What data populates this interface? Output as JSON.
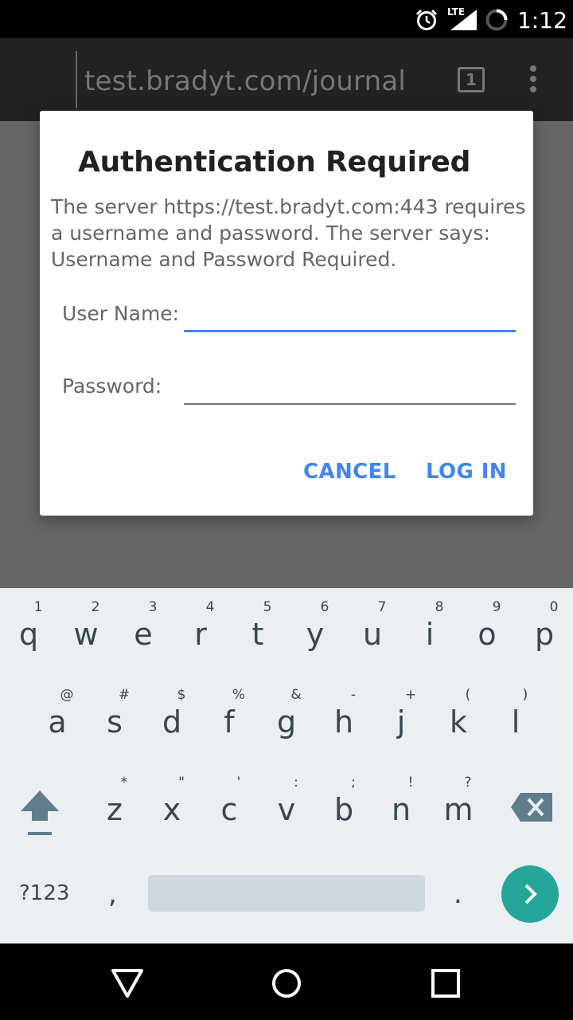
{
  "status_bar": {
    "time": "1:12",
    "network": "LTE",
    "icons": [
      "alarm-icon",
      "signal-icon",
      "battery-icon"
    ]
  },
  "toolbar": {
    "url": "test.bradyt.com/journal",
    "tab_count": "1",
    "menu_icon": "overflow-menu-icon"
  },
  "dialog": {
    "title": "Authentication Required",
    "message": "The server https://test.bradyt.com:443 requires a username and password. The server says: Username and Password Required.",
    "username_label": "User Name:",
    "username_value": "",
    "password_label": "Password:",
    "password_value": "",
    "cancel_label": "CANCEL",
    "login_label": "LOG IN",
    "accent_color": "#4285f4"
  },
  "keyboard": {
    "row1": [
      {
        "key": "q",
        "hint": "1"
      },
      {
        "key": "w",
        "hint": "2"
      },
      {
        "key": "e",
        "hint": "3"
      },
      {
        "key": "r",
        "hint": "4"
      },
      {
        "key": "t",
        "hint": "5"
      },
      {
        "key": "y",
        "hint": "6"
      },
      {
        "key": "u",
        "hint": "7"
      },
      {
        "key": "i",
        "hint": "8"
      },
      {
        "key": "o",
        "hint": "9"
      },
      {
        "key": "p",
        "hint": "0"
      }
    ],
    "row2": [
      {
        "key": "a",
        "hint": "@"
      },
      {
        "key": "s",
        "hint": "#"
      },
      {
        "key": "d",
        "hint": "$"
      },
      {
        "key": "f",
        "hint": "%"
      },
      {
        "key": "g",
        "hint": "&"
      },
      {
        "key": "h",
        "hint": "-"
      },
      {
        "key": "j",
        "hint": "+"
      },
      {
        "key": "k",
        "hint": "("
      },
      {
        "key": "l",
        "hint": ")"
      }
    ],
    "row3": [
      {
        "key": "z",
        "hint": "*"
      },
      {
        "key": "x",
        "hint": "\""
      },
      {
        "key": "c",
        "hint": "'"
      },
      {
        "key": "v",
        "hint": ":"
      },
      {
        "key": "b",
        "hint": ";"
      },
      {
        "key": "n",
        "hint": "!"
      },
      {
        "key": "m",
        "hint": "?"
      }
    ],
    "symbols_label": "?123",
    "comma": ",",
    "period": ".",
    "go_color": "#26a69a"
  },
  "navbar": {
    "icons": [
      "back-icon",
      "home-icon",
      "recents-icon"
    ]
  }
}
